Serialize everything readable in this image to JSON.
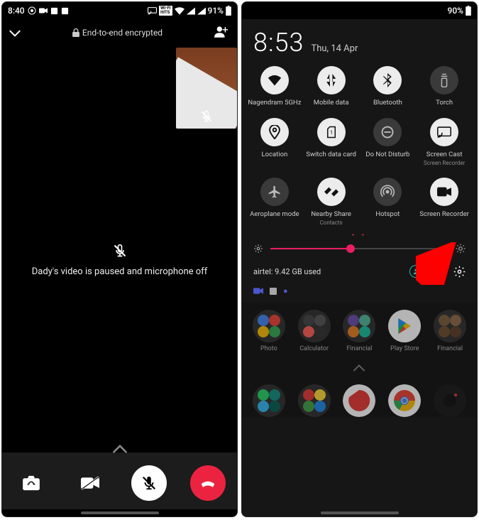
{
  "left": {
    "status_time": "8:40",
    "battery": "91%",
    "encryption": "End-to-end encrypted",
    "call_message": "Dady's video is paused and microphone off"
  },
  "right": {
    "battery": "90%",
    "time": "8:53",
    "date": "Thu, 14 Apr",
    "tiles": [
      {
        "label": "Nagendram 5GHz",
        "icon": "wifi",
        "on": true
      },
      {
        "label": "Mobile data",
        "icon": "data",
        "on": true
      },
      {
        "label": "Bluetooth",
        "icon": "bluetooth",
        "on": true
      },
      {
        "label": "Torch",
        "icon": "torch",
        "on": false
      },
      {
        "label": "Location",
        "icon": "location",
        "on": true
      },
      {
        "label": "Switch data card",
        "icon": "sim",
        "on": true
      },
      {
        "label": "Do Not Disturb",
        "icon": "dnd",
        "on": false
      },
      {
        "label": "Screen Cast",
        "sub": "Screen Recorder",
        "icon": "cast",
        "on": true
      },
      {
        "label": "Aeroplane mode",
        "icon": "plane",
        "on": false
      },
      {
        "label": "Nearby Share",
        "sub": "Contacts",
        "icon": "nearby",
        "on": true
      },
      {
        "label": "Hotspot",
        "icon": "hotspot",
        "on": false
      },
      {
        "label": "Screen Recorder",
        "icon": "record",
        "on": true
      }
    ],
    "data_usage": "airtel: 9.42 GB used",
    "apps": [
      {
        "label": "Photo"
      },
      {
        "label": "Calculator"
      },
      {
        "label": "Financial"
      },
      {
        "label": "Play Store"
      },
      {
        "label": "Financial"
      }
    ]
  }
}
